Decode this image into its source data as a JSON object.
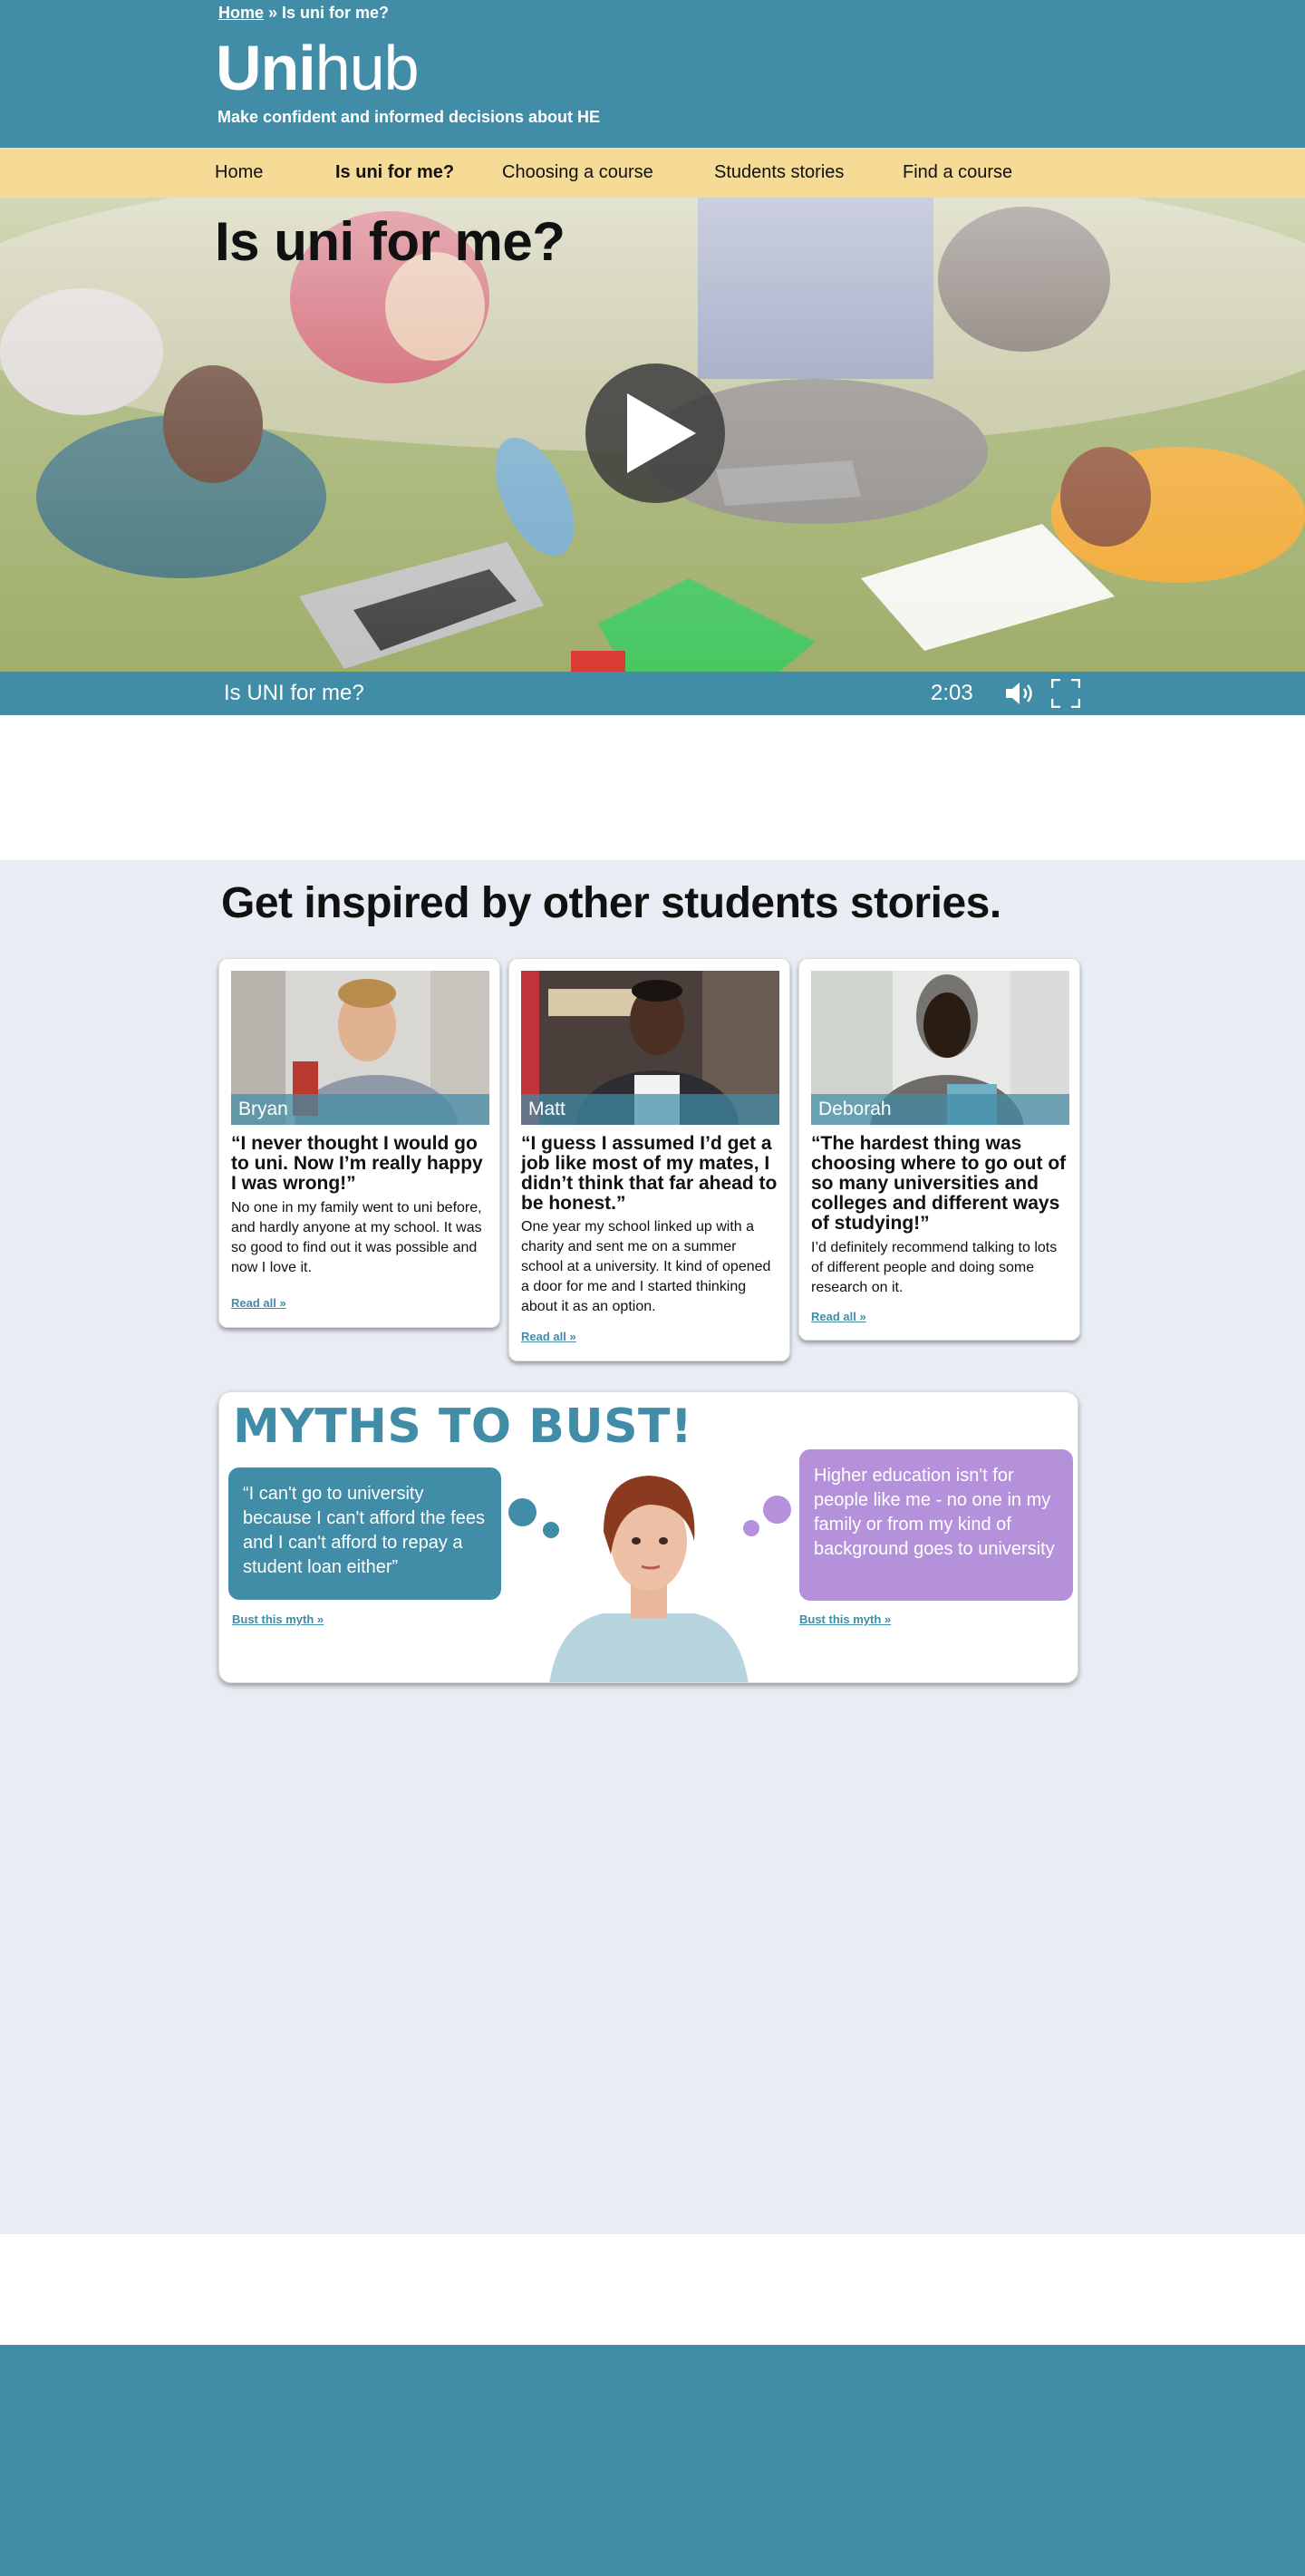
{
  "breadcrumb": {
    "home": "Home",
    "separator": " » ",
    "current": "Is uni for me?"
  },
  "brand": {
    "logo_bold": "Uni",
    "logo_light": "hub",
    "tagline": "Make confident and informed decisions about HE"
  },
  "nav": {
    "items": [
      {
        "label": "Home"
      },
      {
        "label": "Is uni for me?"
      },
      {
        "label": "Choosing a course"
      },
      {
        "label": "Students stories"
      },
      {
        "label": "Find a course"
      }
    ]
  },
  "hero": {
    "title": "Is uni for me?"
  },
  "video": {
    "title": "Is UNI for me?",
    "duration": "2:03",
    "volume_icon": "speaker-icon",
    "fullscreen_icon": "fullscreen-icon"
  },
  "stories": {
    "heading": "Get inspired by other students stories.",
    "cards": [
      {
        "name": "Bryan",
        "quote": "“I never thought I would go to uni. Now I’m really happy I was wrong!”",
        "body": "No one in my family went to uni before, and hardly anyone at my school. It was so good to find out it was possible and now I love it.",
        "link": "Read all »"
      },
      {
        "name": "Matt",
        "quote": "“I guess I assumed I’d get a job like most of my mates, I didn’t think that far ahead to be honest.”",
        "body": "One year my school linked up with a charity and sent me on a summer school at a university. It kind of opened a door for me and I started thinking about it as an option.",
        "link": "Read all »"
      },
      {
        "name": "Deborah",
        "quote": "“The hardest thing was choosing where to go out of so many universities and colleges and different ways of studying!”",
        "body": "I’d definitely recommend talking to lots of different people and doing some research on it.",
        "link": "Read all »"
      }
    ]
  },
  "myths": {
    "title": "MYTHS TO BUST!",
    "left": {
      "text": "“I can't go to university because I can't afford the fees and I can't afford to repay a student loan either”",
      "link": "Bust this myth »"
    },
    "right": {
      "text": "Higher education isn't for people like me - no one in my family or from my kind of background goes to university",
      "link": "Bust this myth »"
    }
  },
  "colors": {
    "primary": "#418ca6",
    "nav_bg": "#f6db96",
    "section_bg": "#e8ecf3",
    "myth_purple": "#b591dc"
  }
}
